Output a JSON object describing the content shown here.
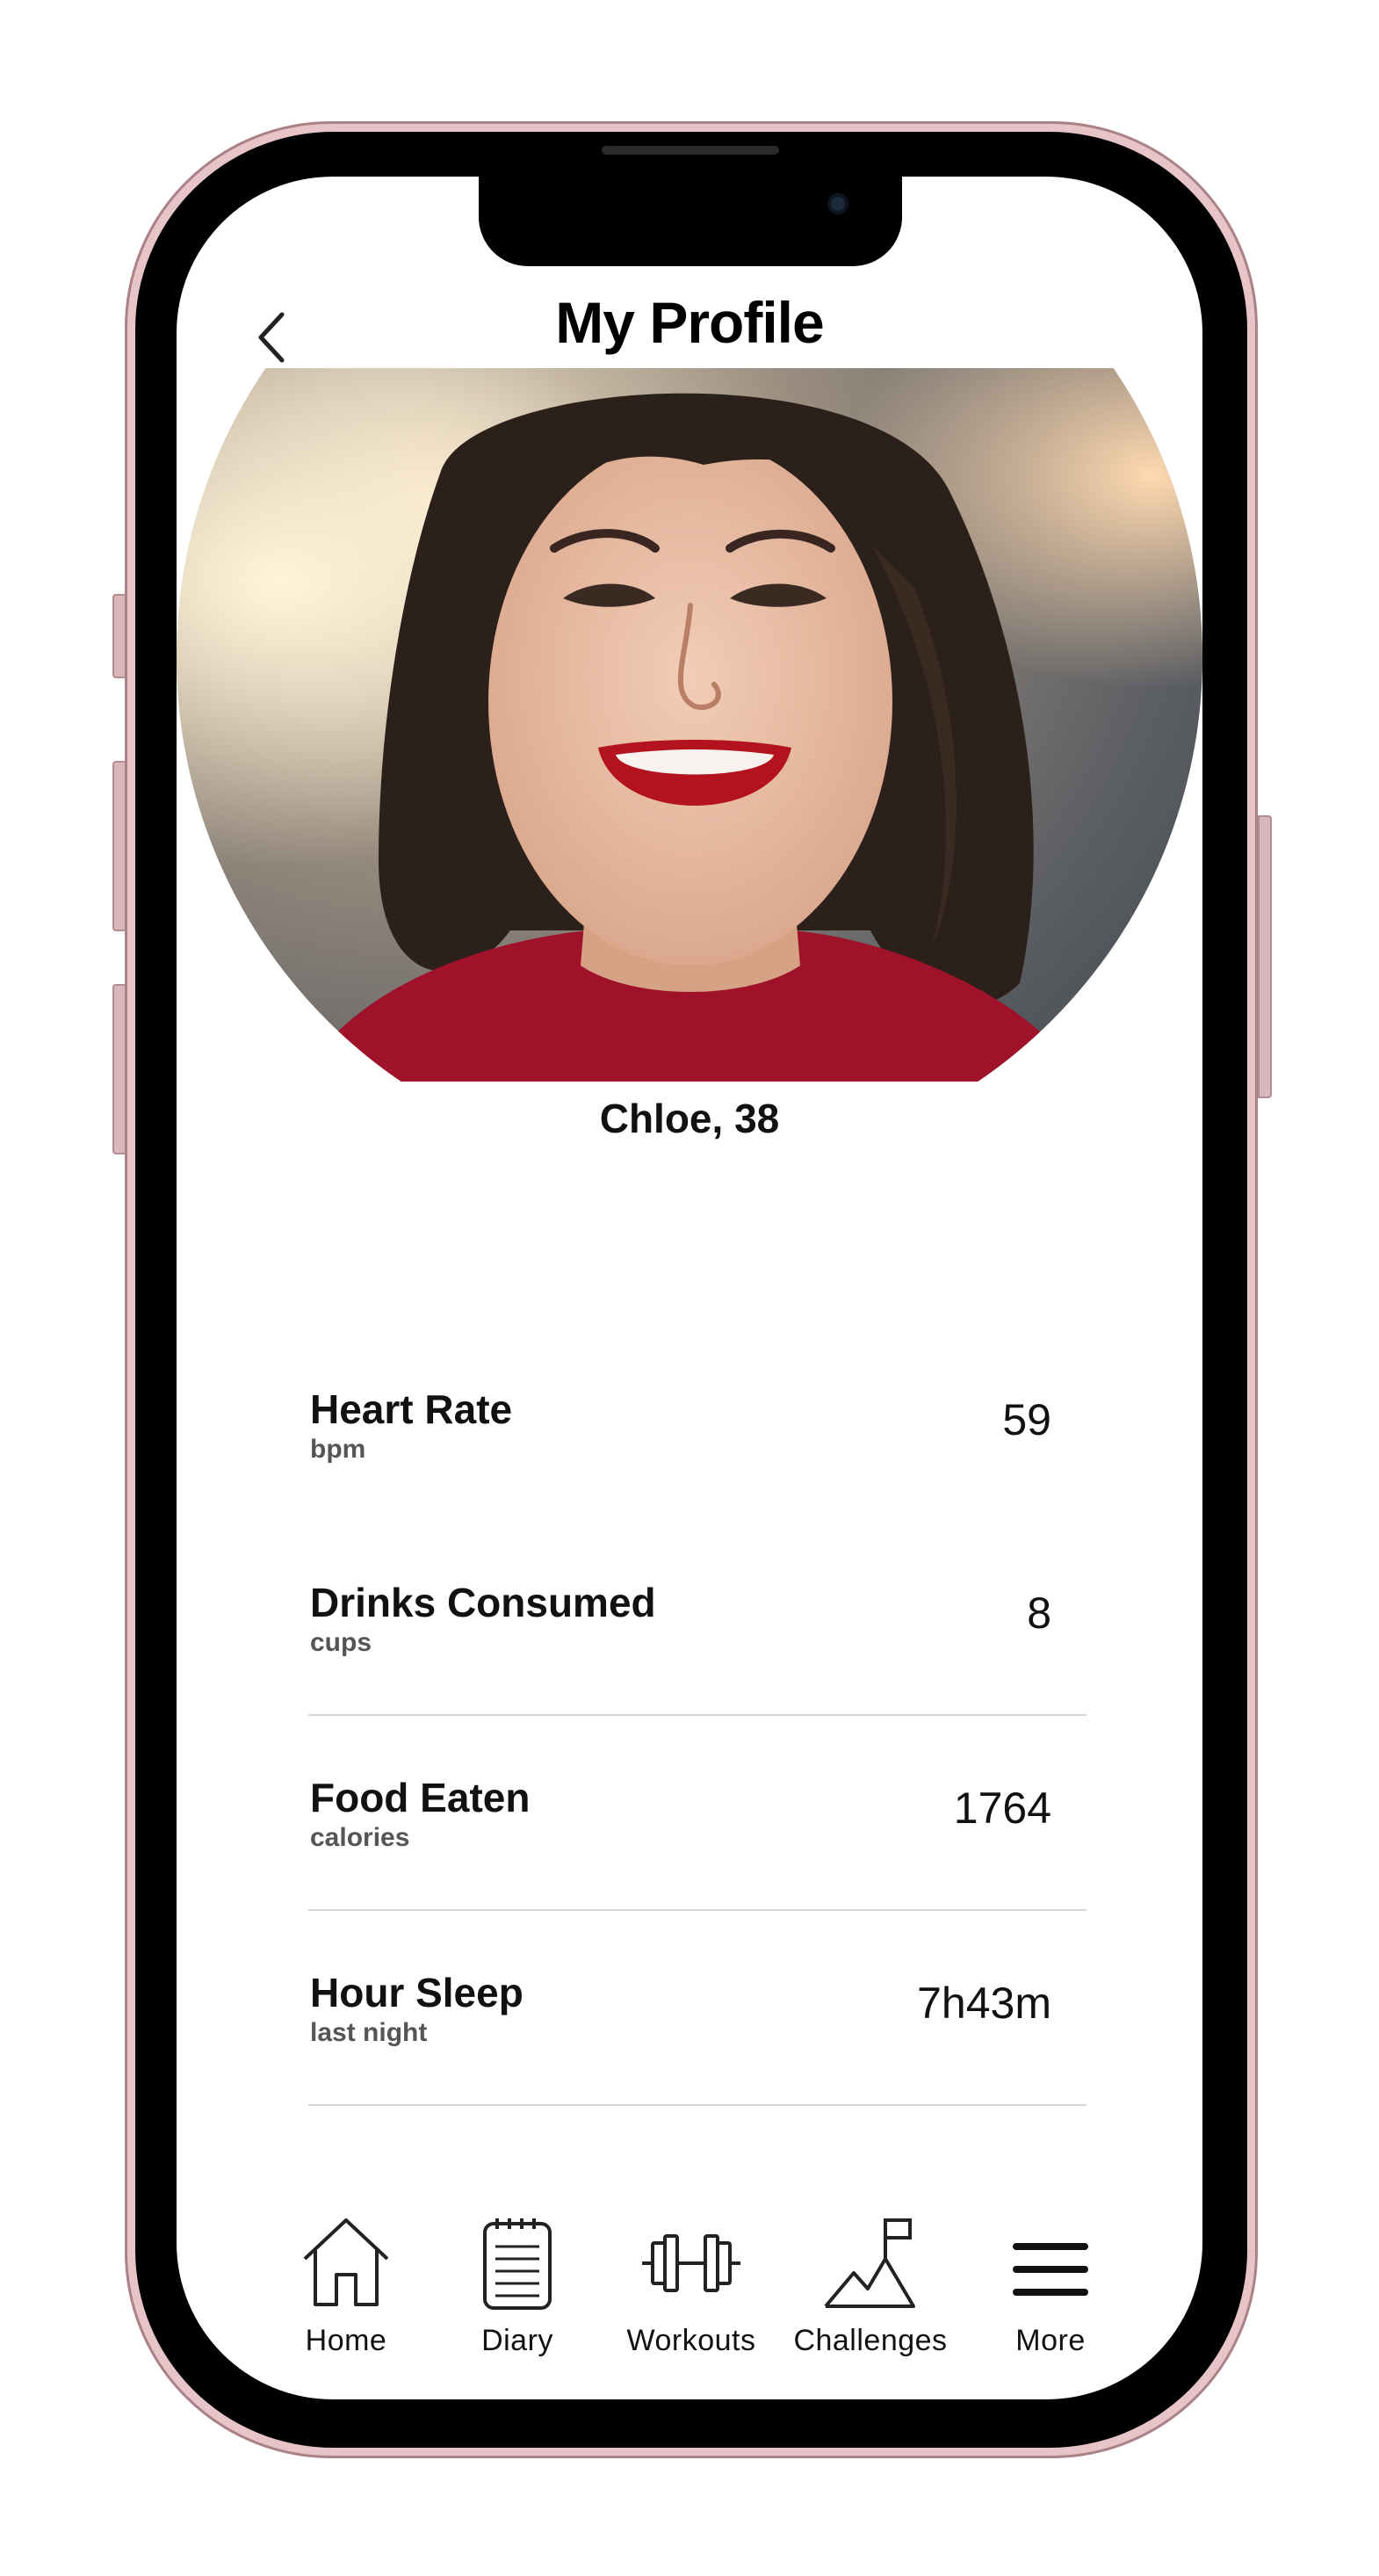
{
  "header": {
    "title": "My Profile",
    "back_icon": "chevron-left-icon"
  },
  "profile": {
    "name_age": "Chloe, 38"
  },
  "stats": [
    {
      "title": "Heart Rate",
      "unit": "bpm",
      "value": "59"
    },
    {
      "title": "Drinks Consumed",
      "unit": "cups",
      "value": "8"
    },
    {
      "title": "Food Eaten",
      "unit": "calories",
      "value": "1764"
    },
    {
      "title": "Hour Sleep",
      "unit": "last night",
      "value": "7h43m"
    }
  ],
  "tabbar": {
    "items": [
      {
        "label": "Home",
        "icon": "home-icon"
      },
      {
        "label": "Diary",
        "icon": "notepad-icon"
      },
      {
        "label": "Workouts",
        "icon": "dumbbell-icon"
      },
      {
        "label": "Challenges",
        "icon": "mountain-flag-icon"
      },
      {
        "label": "More",
        "icon": "menu-icon"
      }
    ]
  },
  "colors": {
    "phone_frame": "#e7c4c7",
    "divider": "#d6d6d6",
    "text": "#111111",
    "subtext": "#555555"
  }
}
